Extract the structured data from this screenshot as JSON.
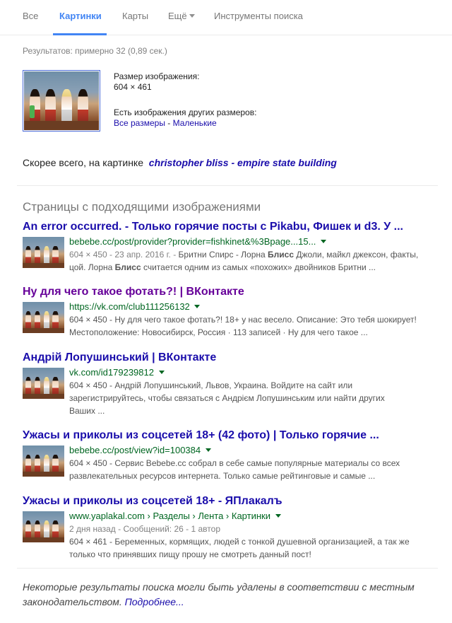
{
  "tabs": [
    {
      "label": "Все"
    },
    {
      "label": "Картинки"
    },
    {
      "label": "Карты"
    },
    {
      "label": "Ещё"
    },
    {
      "label": "Инструменты поиска"
    }
  ],
  "stats": "Результатов: примерно 32 (0,89 сек.)",
  "image_info": {
    "size_label": "Размер изображения:",
    "size_value": "604 × 461",
    "other_sizes_label": "Есть изображения других размеров:",
    "all_sizes": "Все размеры",
    "separator": " - ",
    "small": "Маленькие"
  },
  "best_guess": {
    "prefix": "Скорее всего, на картинке",
    "query": "christopher bliss - empire state building"
  },
  "section_title": "Страницы с подходящими изображениями",
  "results": [
    {
      "title": "An error occurred. - Только горячие посты с Pikabu, Фишек и d3. У ...",
      "url": "bebebe.cc/post/provider?provider=fishkinet&%3Bpage...15...",
      "meta": "604 × 450 - 23 апр. 2016 г. - ",
      "snippet_a": "Бритни Спирс - Лорна ",
      "bold_1": "Блисс",
      "snippet_b": " Джоли, майкл джексон, факты,",
      "snippet_c": "цой. Лорна ",
      "bold_2": "Блисс",
      "snippet_d": " считается одним из самых «похожих» двойников Бритни ..."
    },
    {
      "title": "Ну для чего такое фотать?! | ВКонтакте",
      "url": "https://vk.com/club111256132",
      "line1": "604 × 450 - Ну для чего такое фотать?! 18+ у нас весело. Описание: Это тебя шокирует!",
      "line2": "Местоположение: Новосибирск, Россия · 113 записей · Ну для чего такое ..."
    },
    {
      "title": "Андрій Лопушинський | ВКонтакте",
      "url": "vk.com/id179239812",
      "line1": "604 × 450 - Андрій Лопушинський, Львов, Украина. Войдите на сайт или",
      "line2": "зарегистрируйтесь, чтобы связаться с Андрієм Лопушинським или найти других",
      "line3": "Ваших ..."
    },
    {
      "title": "Ужасы и приколы из соцсетей 18+ (42 фото) | Только горячие ...",
      "url": "bebebe.cc/post/view?id=100384",
      "line1": "604 × 450 - Сервис Bebebe.cc собрал в себе самые популярные материалы со всех",
      "line2": "развлекательных ресурсов интернета. Только самые рейтинговые и самые ..."
    },
    {
      "title": "Ужасы и приколы из соцсетей 18+ - ЯПлакалъ",
      "url": "www.yaplakal.com › Разделы › Лента › Картинки",
      "line1": "2 дня назад - Сообщений: 26 - 1 автор",
      "line2": "604 × 461 - Беременных, кормящих, людей с тонкой душевной организацией, а так же",
      "line3": "только что принявших пищу прошу не смотреть данный пост!"
    }
  ],
  "footer": {
    "text": "Некоторые результаты поиска могли быть удалены в соответствии с местным законодательством.",
    "link": "Подробнее..."
  },
  "colors": {
    "accent": "#4285f4",
    "link": "#1a0dab",
    "visited": "#660099",
    "url_green": "#006621"
  }
}
